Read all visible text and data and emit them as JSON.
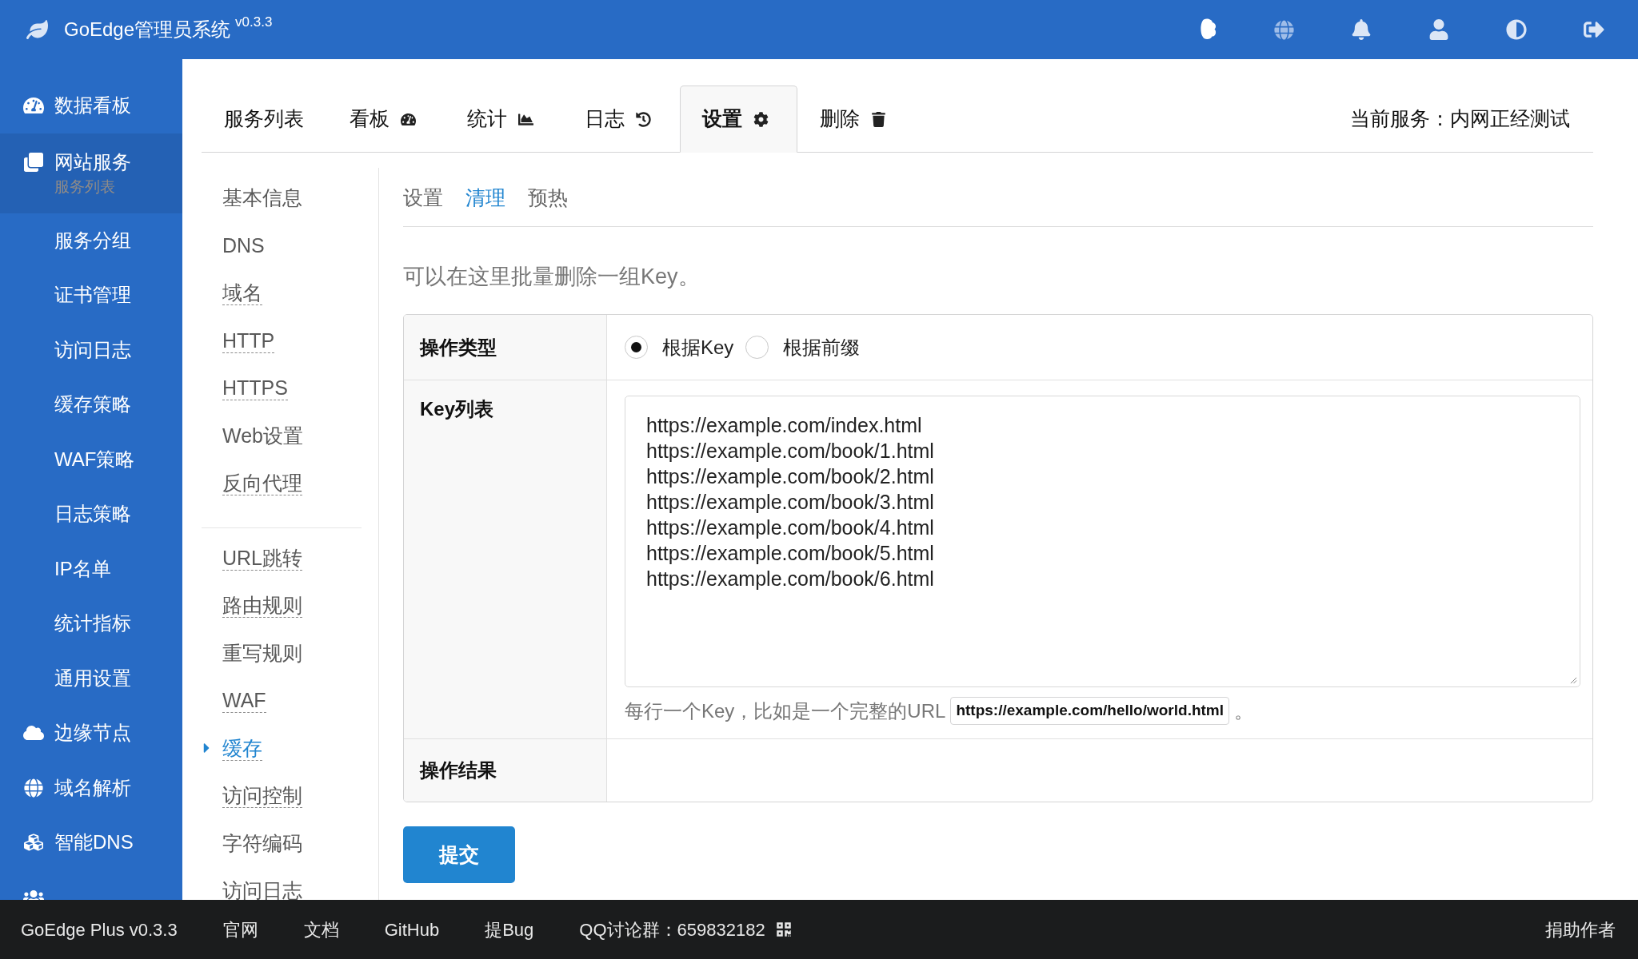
{
  "header": {
    "title": "GoEdge管理员系统",
    "version": "v0.3.3"
  },
  "sidebar": {
    "items": [
      {
        "label": "数据看板",
        "selected": false
      },
      {
        "label": "网站服务",
        "subtitle": "服务列表",
        "selected": true,
        "children": [
          {
            "label": "服务分组",
            "selected": false
          },
          {
            "label": "证书管理",
            "selected": false
          },
          {
            "label": "访问日志",
            "selected": false
          },
          {
            "label": "缓存策略",
            "selected": false
          },
          {
            "label": "WAF策略",
            "selected": false
          },
          {
            "label": "日志策略",
            "selected": false
          },
          {
            "label": "IP名单",
            "selected": false
          },
          {
            "label": "统计指标",
            "selected": false
          },
          {
            "label": "通用设置",
            "selected": false
          }
        ]
      },
      {
        "label": "边缘节点",
        "selected": false
      },
      {
        "label": "域名解析",
        "selected": false
      },
      {
        "label": "智能DNS",
        "selected": false
      },
      {
        "selected": false
      }
    ]
  },
  "tabs": [
    {
      "label": "服务列表",
      "selected": false
    },
    {
      "label": "看板",
      "selected": false
    },
    {
      "label": "统计",
      "selected": false
    },
    {
      "label": "日志",
      "selected": false
    },
    {
      "label": "设置",
      "selected": true
    },
    {
      "label": "删除",
      "selected": false
    }
  ],
  "current_service": "当前服务：内网正经测试",
  "menu": {
    "groups": [
      {
        "items": [
          {
            "label": "基本信息",
            "configured": false,
            "selected": false
          },
          {
            "label": "DNS",
            "configured": false,
            "selected": false
          },
          {
            "label": "域名",
            "configured": true,
            "selected": false
          },
          {
            "label": "HTTP",
            "configured": true,
            "selected": false
          },
          {
            "label": "HTTPS",
            "configured": true,
            "selected": false
          },
          {
            "label": "Web设置",
            "configured": false,
            "selected": false
          },
          {
            "label": "反向代理",
            "configured": true,
            "selected": false
          }
        ]
      },
      {
        "items": [
          {
            "label": "URL跳转",
            "configured": true,
            "selected": false
          },
          {
            "label": "路由规则",
            "configured": true,
            "selected": false
          },
          {
            "label": "重写规则",
            "configured": false,
            "selected": false
          },
          {
            "label": "WAF",
            "configured": true,
            "selected": false
          },
          {
            "label": "缓存",
            "configured": true,
            "selected": true
          },
          {
            "label": "访问控制",
            "configured": true,
            "selected": false
          },
          {
            "label": "字符编码",
            "configured": false,
            "selected": false
          },
          {
            "label": "访问日志",
            "selected": false
          }
        ]
      }
    ]
  },
  "subtabs": [
    {
      "label": "设置",
      "selected": false
    },
    {
      "label": "清理",
      "selected": true
    },
    {
      "label": "预热",
      "selected": false
    }
  ],
  "description": "可以在这里批量删除一组Key。",
  "form": {
    "rows": [
      {
        "kind": "radio",
        "label": "操作类型",
        "options": [
          {
            "label": "根据Key",
            "selected": true
          },
          {
            "label": "根据前缀",
            "selected": false
          }
        ]
      },
      {
        "kind": "textarea",
        "label": "Key列表",
        "value": "https://example.com/index.html\nhttps://example.com/book/1.html\nhttps://example.com/book/2.html\nhttps://example.com/book/3.html\nhttps://example.com/book/4.html\nhttps://example.com/book/5.html\nhttps://example.com/book/6.html",
        "hint": "每行一个Key，比如是一个完整的URL",
        "hint_example": "https://example.com/hello/world.html",
        "hint_end": "。"
      },
      {
        "kind": "result",
        "label": "操作结果"
      }
    ]
  },
  "submit_button": "提交",
  "footer": {
    "brand": "GoEdge Plus v0.3.3",
    "links": [
      "官网",
      "文档",
      "GitHub",
      "提Bug"
    ],
    "qq_group": "QQ讨论群：659832182",
    "donate": "捐助作者"
  }
}
